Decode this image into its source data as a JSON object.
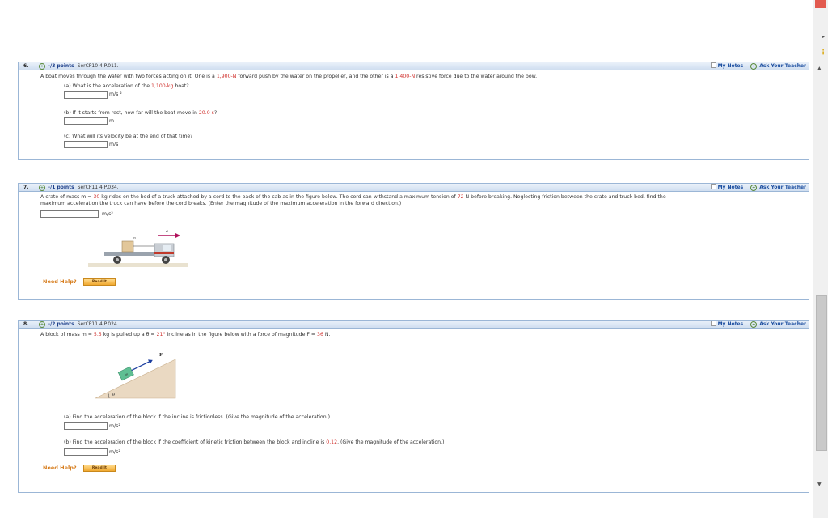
{
  "questions": [
    {
      "num": "6.",
      "points": "–/3 points",
      "code": "SerCP10 4.P.011.",
      "my_notes": "My Notes",
      "ask_teacher": "Ask Your Teacher",
      "prompt_pre": "A boat moves through the water with two forces acting on it. One is a ",
      "force1": "1,900-N",
      "prompt_mid": " forward push by the water on the propeller, and the other is a ",
      "force2": "1,400-N",
      "prompt_post": " resistive force due to the water around the bow.",
      "parts": [
        {
          "label_pre": "(a) What is the acceleration of the ",
          "highlight": "1,100-kg",
          "label_post": " boat?",
          "unit": "m/s ²"
        },
        {
          "label_pre": "(b) If it starts from rest, how far will the boat move in ",
          "highlight": "20.0 s",
          "label_post": "?",
          "unit": "m"
        },
        {
          "label_pre": "(c) What will its velocity be at the end of that time?",
          "highlight": "",
          "label_post": "",
          "unit": "m/s"
        }
      ]
    },
    {
      "num": "7.",
      "points": "–/1 points",
      "code": "SerCP11 4.P.034.",
      "my_notes": "My Notes",
      "ask_teacher": "Ask Your Teacher",
      "line1_pre": "A crate of mass  m  =  ",
      "mass": "30",
      "line1_mid": " kg  rides on the bed of a truck attached by a cord to the back of the cab as in the figure below. The cord can withstand a maximum tension of ",
      "tension": "72",
      "line1_post": " N before breaking. Neglecting friction between the crate and truck bed, find the",
      "line2": "maximum acceleration the truck can have before the cord breaks. (Enter the magnitude of the maximum acceleration in the forward direction.)",
      "unit": "m/s²",
      "fig_mass_label": "m",
      "fig_accel_label": "a",
      "need_help": "Need Help?",
      "read_it": "Read It"
    },
    {
      "num": "8.",
      "points": "–/2 points",
      "code": "SerCP11 4.P.024.",
      "my_notes": "My Notes",
      "ask_teacher": "Ask Your Teacher",
      "line_pre": "A block of mass  m  =  ",
      "mass": "5.5",
      "line_mid1": " kg  is pulled up a  θ  =  ",
      "angle": "21°",
      "line_mid2": "  incline as in the figure below with a force of magnitude  F  =  ",
      "force": "36",
      "line_post": " N.",
      "fig_mass_label": "m",
      "fig_force_label": "F",
      "fig_angle_label": "θ",
      "part_a": "(a) Find the acceleration of the block if the incline is frictionless. (Give the magnitude of the acceleration.)",
      "part_b_pre": "(b) Find the acceleration of the block if the coefficient of kinetic friction between the block and incline is ",
      "mu": "0.12",
      "part_b_post": ". (Give the magnitude of the acceleration.)",
      "unit": "m/s²",
      "need_help": "Need Help?",
      "read_it": "Read It"
    }
  ],
  "colors": {
    "highlight": "#d0312d",
    "header_border": "#9bb6d6",
    "link": "#1d4fa0",
    "help": "#d67b1a"
  }
}
